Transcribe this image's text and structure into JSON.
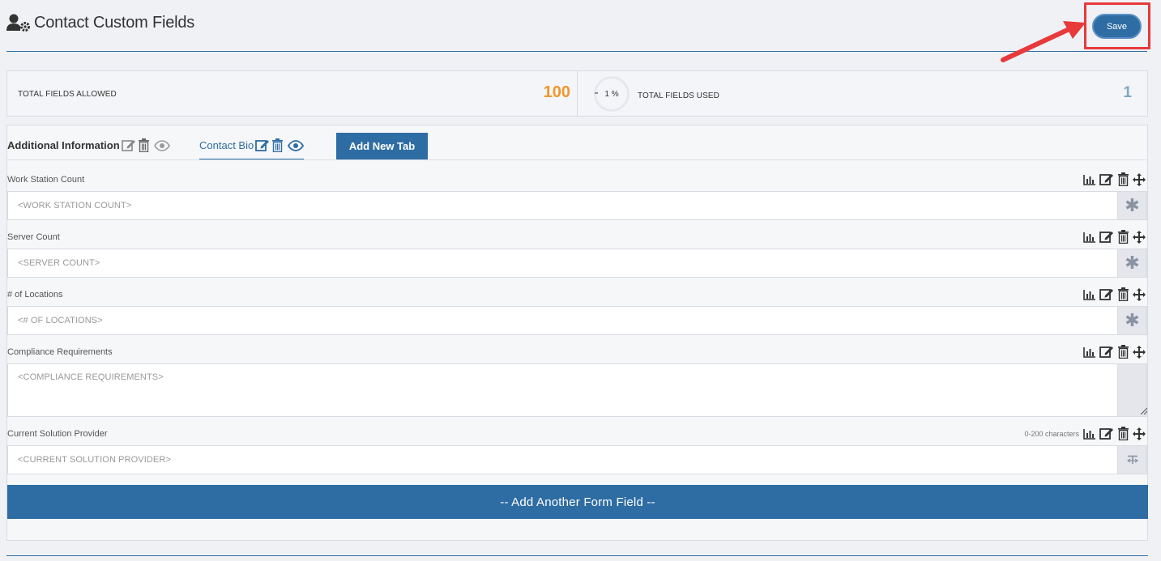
{
  "header": {
    "title": "Contact Custom Fields",
    "save_label": "Save"
  },
  "stats": {
    "allowed_label": "TOTAL FIELDS ALLOWED",
    "allowed_value": "100",
    "used_percent": "1 %",
    "used_label": "TOTAL FIELDS USED",
    "used_value": "1"
  },
  "tabs": [
    {
      "label": "Additional Information"
    },
    {
      "label": "Contact Bio"
    }
  ],
  "add_tab_label": "Add New Tab",
  "fields": [
    {
      "label": "Work Station Count",
      "placeholder": "<WORK STATION COUNT>",
      "addon": "asterisk"
    },
    {
      "label": "Server Count",
      "placeholder": "<SERVER COUNT>",
      "addon": "asterisk"
    },
    {
      "label": "# of Locations",
      "placeholder": "<# OF LOCATIONS>",
      "addon": "asterisk"
    },
    {
      "label": "Compliance Requirements",
      "placeholder": "<COMPLIANCE REQUIREMENTS>",
      "addon": "none"
    },
    {
      "label": "Current Solution Provider",
      "placeholder": "<CURRENT SOLUTION PROVIDER>",
      "addon": "text-size",
      "hint": "0-200 characters"
    }
  ],
  "add_field_label": "-- Add Another Form Field --",
  "colors": {
    "primary": "#2e6da4",
    "orange": "#f0972c",
    "highlight": "#e8393b"
  }
}
